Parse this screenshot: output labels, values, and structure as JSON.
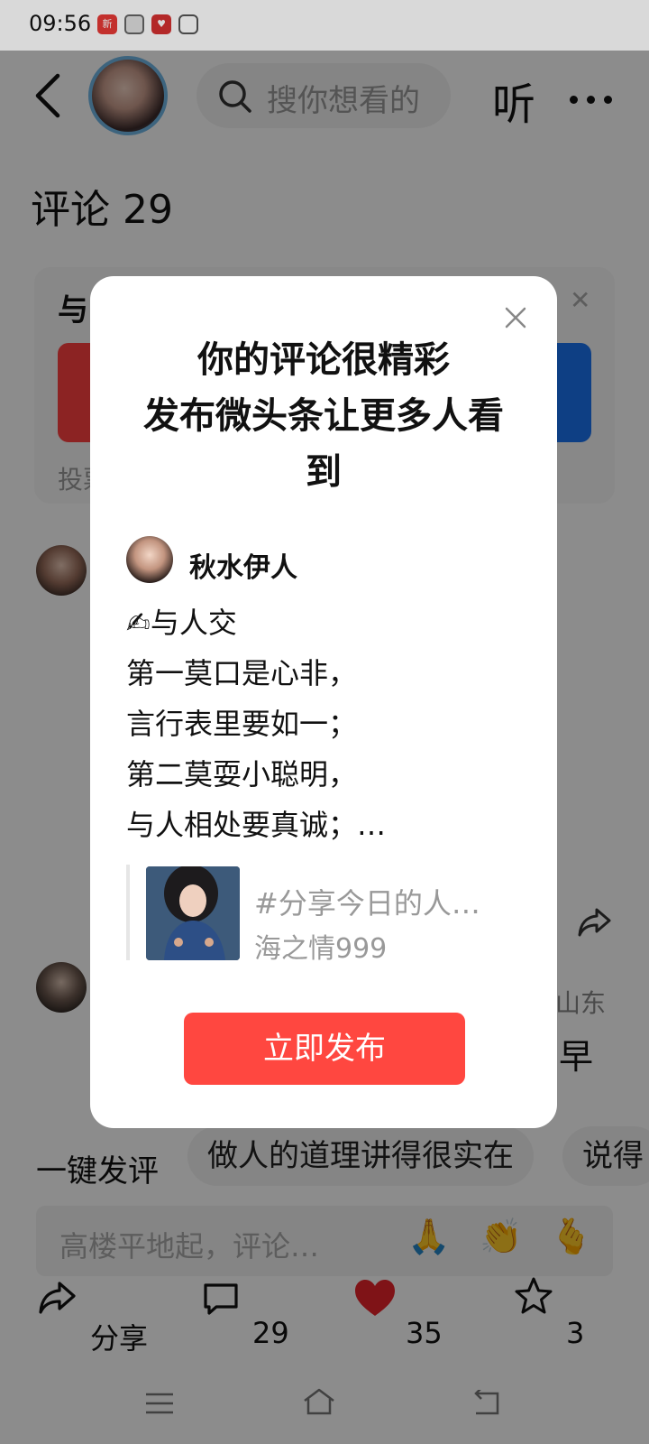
{
  "status_bar": {
    "time": "09:56",
    "icons": [
      "news-app-icon",
      "mail-icon",
      "red-app-icon",
      "settings-app-icon"
    ]
  },
  "header": {
    "search_placeholder": "搜你想看的",
    "listen_label": "听"
  },
  "comments": {
    "title": "评论 29"
  },
  "background_card": {
    "title": "与",
    "vote_text": "投票"
  },
  "background_rows": {
    "region": "山东",
    "snippet": "早"
  },
  "quick_comment": {
    "label": "一键发评",
    "chips": [
      "做人的道理讲得很实在",
      "说得"
    ]
  },
  "comment_input": {
    "placeholder": "高楼平地起，评论…",
    "emojis": [
      "🙏",
      "👏",
      "🫰"
    ]
  },
  "bottom_bar": {
    "share_label": "分享",
    "comment_count": "29",
    "like_count": "35",
    "favorite_count": "3"
  },
  "modal": {
    "title_line1": "你的评论很精彩",
    "title_line2": "发布微头条让更多人看",
    "title_line3": "到",
    "author_name": "秋水伊人",
    "post_lines": [
      "✍与人交",
      "第一莫口是心非，",
      "言行表里要如一；",
      "第二莫耍小聪明，",
      "与人相处要真诚；…"
    ],
    "quote_title": "#分享今日的人…",
    "quote_author": "海之情999",
    "publish_button": "立即发布"
  },
  "colors": {
    "primary_red": "#ff4740",
    "like_red": "#e8242b",
    "blue": "#1a73f0"
  }
}
